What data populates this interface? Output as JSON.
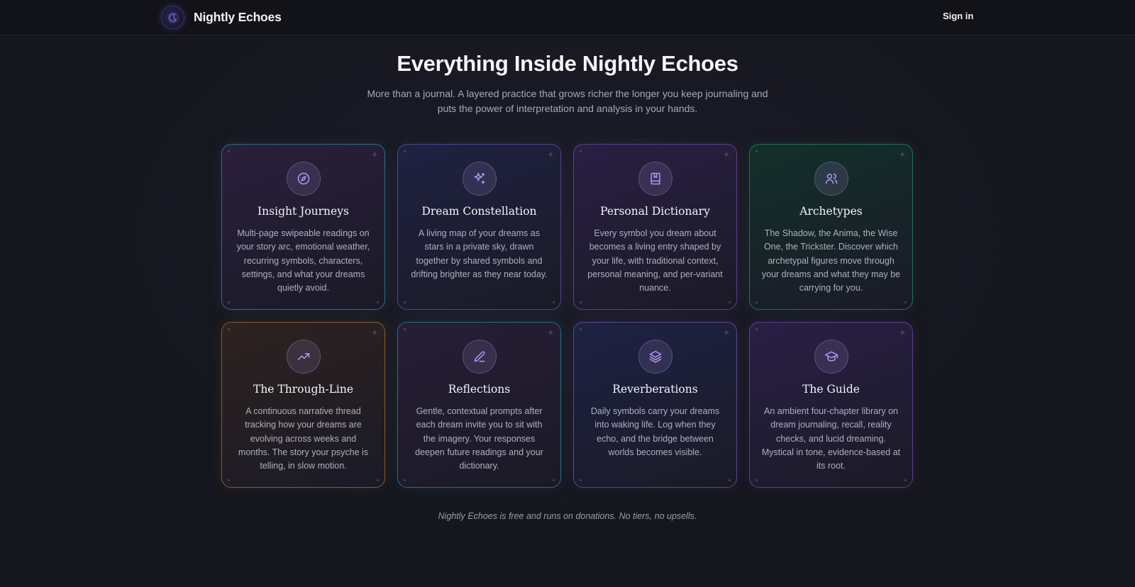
{
  "header": {
    "brand_name": "Nightly Echoes",
    "signin_label": "Sign in",
    "logo_icon": "crescent-moon-icon"
  },
  "hero": {
    "title": "Everything Inside Nightly Echoes",
    "subtitle": "More than a journal. A layered practice that grows richer the longer you keep journaling and puts the power of interpretation and analysis in your hands."
  },
  "colors": {
    "background": "#15161e",
    "icon_accent": "#b596f2"
  },
  "features": [
    {
      "title": "Insight Journeys",
      "icon": "compass-icon",
      "description": "Multi-page swipeable readings on your story arc, emotional weather, recurring symbols, characters, settings, and what your dreams quietly avoid.",
      "border": "#2c6f86",
      "bg": "#2a1f3c"
    },
    {
      "title": "Dream Constellation",
      "icon": "sparkles-icon",
      "description": "A living map of your dreams as stars in a private sky, drawn together by shared symbols and drifting brighter as they near today.",
      "border": "#4f4488",
      "bg": "#1f2242"
    },
    {
      "title": "Personal Dictionary",
      "icon": "book-icon",
      "description": "Every symbol you dream about becomes a living entry shaped by your life, with traditional context, personal meaning, and per-variant nuance.",
      "border": "#5a3e86",
      "bg": "#2a1f44"
    },
    {
      "title": "Archetypes",
      "icon": "users-icon",
      "description": "The Shadow, the Anima, the Wise One, the Trickster. Discover which archetypal figures move through your dreams and what they may be carrying for you.",
      "border": "#24705a",
      "bg": "#13302b"
    },
    {
      "title": "The Through-Line",
      "icon": "trending-up-icon",
      "description": "A continuous narrative thread tracking how your dreams are evolving across weeks and months. The story your psyche is telling, in slow motion.",
      "border": "#8a5a2e",
      "bg": "#2e2220"
    },
    {
      "title": "Reflections",
      "icon": "pencil-line-icon",
      "description": "Gentle, contextual prompts after each dream invite you to sit with the imagery. Your responses deepen future readings and your dictionary.",
      "border": "#2c6c80",
      "bg": "#271e36"
    },
    {
      "title": "Reverberations",
      "icon": "layers-icon",
      "description": "Daily symbols carry your dreams into waking life. Log when they echo, and the bridge between worlds becomes visible.",
      "border": "#5a4690",
      "bg": "#1e2244"
    },
    {
      "title": "The Guide",
      "icon": "graduation-cap-icon",
      "description": "An ambient four-chapter library on dream journaling, recall, reality checks, and lucid dreaming. Mystical in tone, evidence-based at its root.",
      "border": "#5e3e8e",
      "bg": "#2a1f46"
    }
  ],
  "footer": {
    "note": "Nightly Echoes is free and runs on donations. No tiers, no upsells."
  }
}
